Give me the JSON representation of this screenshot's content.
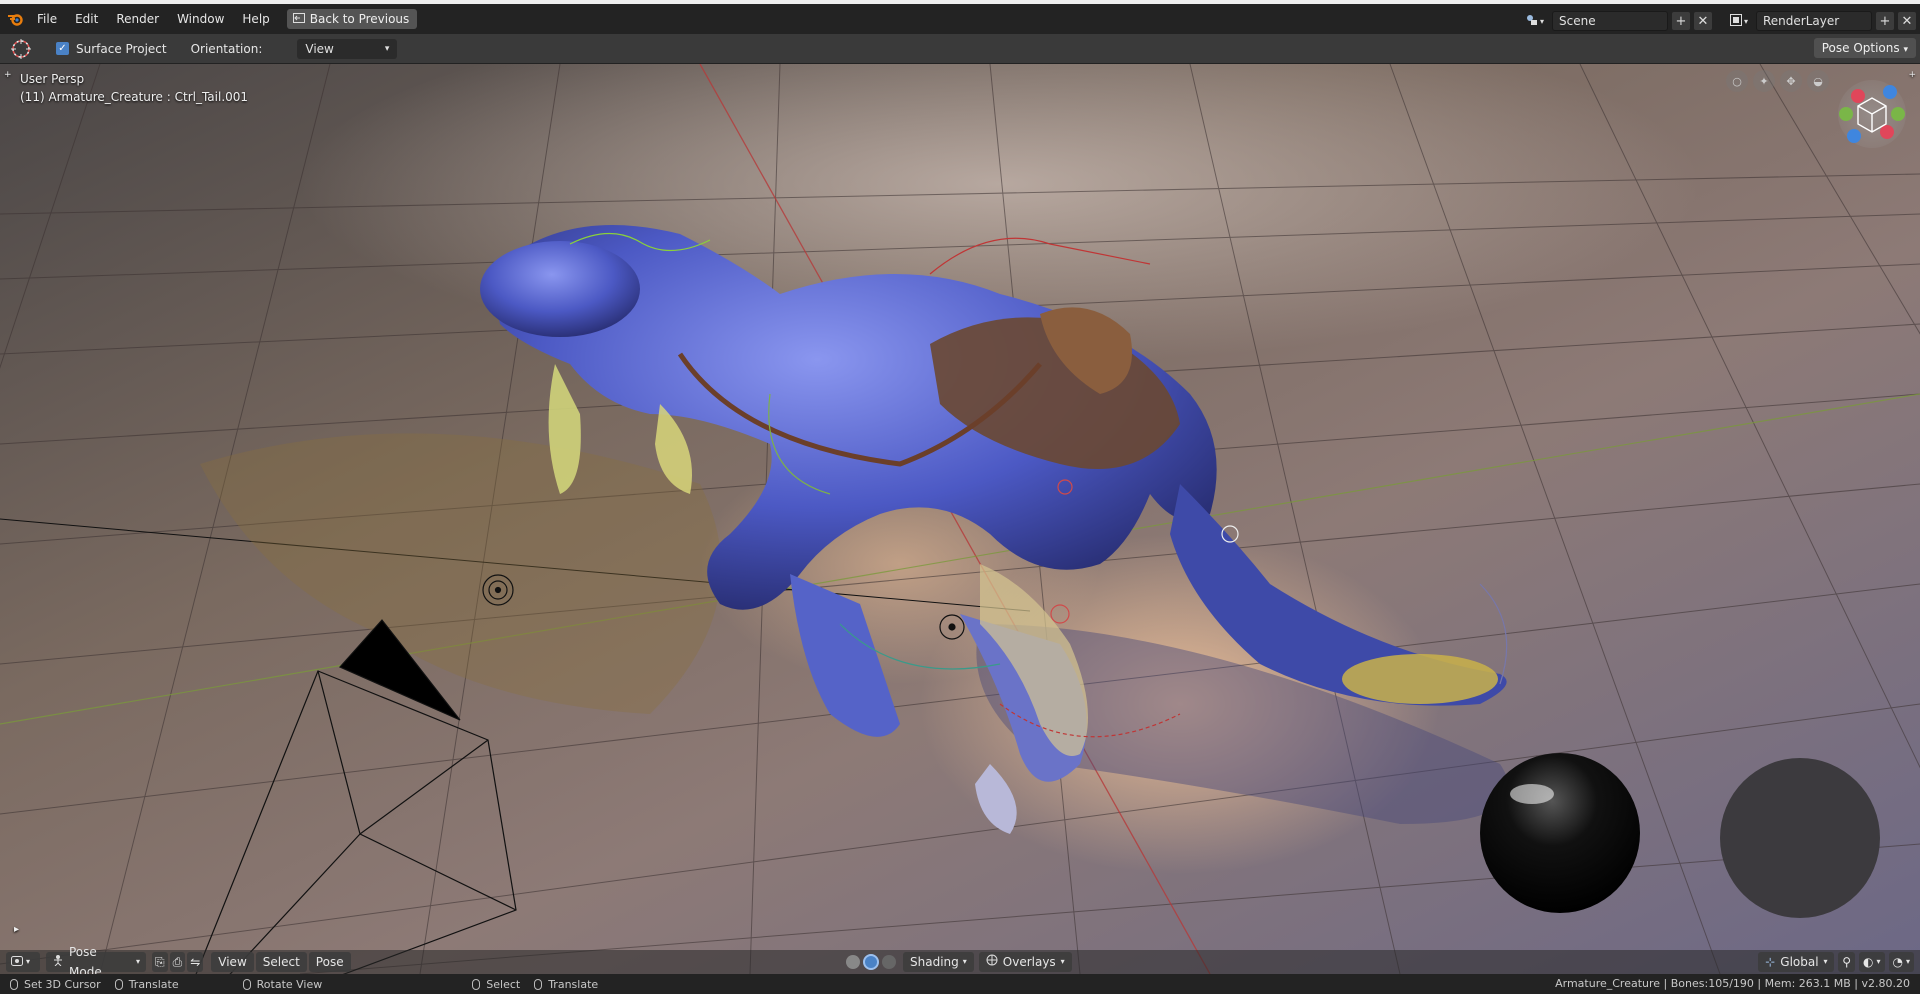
{
  "topbar": {
    "menu": [
      "File",
      "Edit",
      "Render",
      "Window",
      "Help"
    ],
    "back_button": "Back to Previous",
    "scene": "Scene",
    "render_layer": "RenderLayer",
    "icons": [
      "blender-logo-icon",
      "back-icon",
      "scene-icon",
      "renderlayer-icon"
    ]
  },
  "toolbar": {
    "surface_project_label": "Surface Project",
    "surface_project_checked": true,
    "orientation_label": "Orientation:",
    "orientation_value": "View",
    "pose_options": "Pose Options"
  },
  "viewport": {
    "view_name": "User Persp",
    "active_object": "(11) Armature_Creature : Ctrl_Tail.001",
    "colors": {
      "floor_warm": "#b98a66",
      "floor_cool": "#6d6a8a",
      "creature": "#5b6ad1"
    }
  },
  "header": {
    "mode": "Pose Mode",
    "view": "View",
    "select": "Select",
    "pose": "Pose",
    "shading": "Shading",
    "overlays": "Overlays",
    "transform": "Global"
  },
  "status": {
    "left_click": "Set 3D Cursor",
    "drag": "Translate",
    "middle": "Rotate View",
    "select": "Select",
    "translate": "Translate",
    "info": "Armature_Creature | Bones:105/190 | Mem: 263.1 MB | v2.80.20"
  }
}
